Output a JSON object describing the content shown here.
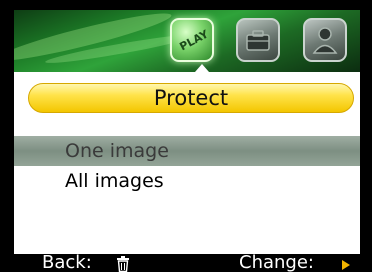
{
  "header": {
    "modes": [
      {
        "name": "play",
        "label": "PLAY",
        "icon": "play-mode-icon",
        "active": true
      },
      {
        "name": "setup",
        "icon": "setup-mode-icon",
        "active": false
      },
      {
        "name": "user",
        "icon": "user-mode-icon",
        "active": false
      }
    ]
  },
  "title": "Protect",
  "menu": {
    "items": [
      {
        "label": "One image",
        "selected": true
      },
      {
        "label": "All images",
        "selected": false
      }
    ]
  },
  "footer": {
    "back_label": "Back:",
    "back_icon": "trash-icon",
    "change_label": "Change:",
    "change_icon": "arrow-right-icon"
  },
  "colors": {
    "title_bar": "#ffe34a",
    "selected_row": "#8a9c8e",
    "header_green": "#1c7a26",
    "change_arrow": "#f3b400"
  }
}
